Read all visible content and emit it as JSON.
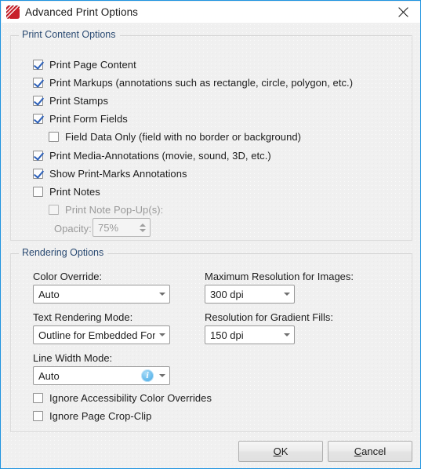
{
  "window": {
    "title": "Advanced Print Options",
    "app_icon": "pdf-xchange-icon",
    "close_icon": "close-icon",
    "border_color": "#1e93e0",
    "titlebar_bg": "#ffffff",
    "client_bg": "#f0f0f0"
  },
  "print_content": {
    "group_title": "Print Content Options",
    "options": [
      {
        "label": "Print Page Content",
        "checked": true,
        "enabled": true
      },
      {
        "label": "Print Markups (annotations such as rectangle, circle, polygon, etc.)",
        "checked": true,
        "enabled": true
      },
      {
        "label": "Print Stamps",
        "checked": true,
        "enabled": true
      },
      {
        "label": "Print Form Fields",
        "checked": true,
        "enabled": true
      },
      {
        "label": "Field Data Only (field with no border or background)",
        "checked": false,
        "enabled": true
      },
      {
        "label": "Print Media-Annotations (movie, sound, 3D, etc.)",
        "checked": true,
        "enabled": true
      },
      {
        "label": "Show Print-Marks Annotations",
        "checked": true,
        "enabled": true
      },
      {
        "label": "Print Notes",
        "checked": false,
        "enabled": true
      },
      {
        "label": "Print Note Pop-Up(s):",
        "checked": false,
        "enabled": false
      }
    ],
    "opacity": {
      "label": "Opacity:",
      "value": "75%",
      "enabled": false
    }
  },
  "rendering": {
    "group_title": "Rendering Options",
    "color_override": {
      "label": "Color Override:",
      "value": "Auto"
    },
    "text_rendering_mode": {
      "label": "Text Rendering Mode:",
      "value": "Outline for Embedded Fonts"
    },
    "line_width_mode": {
      "label": "Line Width Mode:",
      "value": "Auto",
      "info_icon": "info-icon"
    },
    "max_resolution_images": {
      "label": "Maximum Resolution for Images:",
      "value": "300 dpi"
    },
    "resolution_gradient_fills": {
      "label": "Resolution for Gradient Fills:",
      "value": "150 dpi"
    },
    "checkboxes": [
      {
        "label": "Ignore Accessibility Color Overrides",
        "checked": false
      },
      {
        "label": "Ignore Page Crop-Clip",
        "checked": false
      }
    ]
  },
  "footer": {
    "ok": {
      "prefix": "",
      "mnemonic": "O",
      "suffix": "K"
    },
    "cancel": {
      "prefix": "",
      "mnemonic": "C",
      "suffix": "ancel"
    }
  }
}
